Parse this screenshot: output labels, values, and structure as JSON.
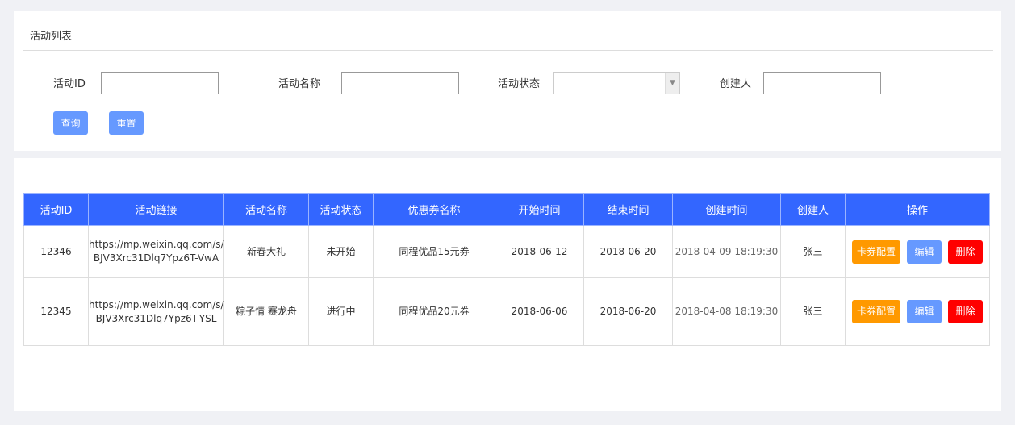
{
  "filter": {
    "title": "活动列表",
    "id_label": "活动ID",
    "name_label": "活动名称",
    "status_label": "活动状态",
    "creator_label": "创建人",
    "id_value": "",
    "name_value": "",
    "status_value": "",
    "creator_value": "",
    "query": "查询",
    "reset": "重置"
  },
  "table": {
    "headers": [
      "活动ID",
      "活动链接",
      "活动名称",
      "活动状态",
      "优惠券名称",
      "开始时间",
      "结束时间",
      "创建时间",
      "创建人",
      "操作"
    ],
    "rows": [
      {
        "id": "12346",
        "link1": "https://mp.weixin.qq.com/s/",
        "link2": "BJV3Xrc31Dlq7Ypz6T-VwA",
        "name": "新春大礼",
        "status": "未开始",
        "coupon": "同程优品15元券",
        "start": "2018-06-12",
        "end": "2018-06-20",
        "created": "2018-04-09 18:19:30",
        "creator": "张三"
      },
      {
        "id": "12345",
        "link1": "https://mp.weixin.qq.com/s/",
        "link2": "BJV3Xrc31Dlq7Ypz6T-YSL",
        "name": "粽子情 赛龙舟",
        "status": "进行中",
        "coupon": "同程优品20元券",
        "start": "2018-06-06",
        "end": "2018-06-20",
        "created": "2018-04-08 18:19:30",
        "creator": "张三"
      }
    ],
    "actions": {
      "config": "卡券配置",
      "edit": "编辑",
      "delete": "删除"
    }
  },
  "colors": {
    "header": "#3366ff",
    "config": "#ff9900",
    "edit": "#6699ff",
    "delete": "#ff0000"
  }
}
